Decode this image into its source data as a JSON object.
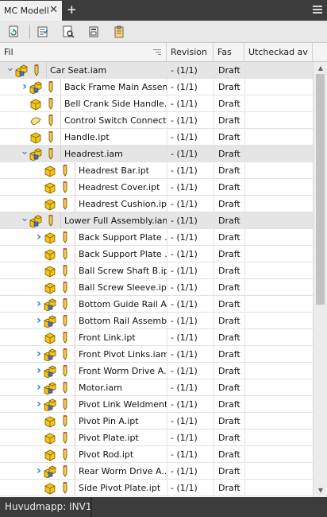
{
  "tab": {
    "title": "MC Modell",
    "close_glyph": "✕",
    "add_glyph": "+"
  },
  "toolbar": {
    "buttons": [
      {
        "name": "refresh-button",
        "icon": "refresh-doc-icon"
      },
      {
        "name": "properties-button",
        "icon": "properties-list-icon"
      },
      {
        "name": "search-button",
        "icon": "doc-search-icon"
      },
      {
        "name": "open-button",
        "icon": "open-doc-icon"
      },
      {
        "name": "clipboard-button",
        "icon": "clipboard-icon"
      }
    ]
  },
  "columns": {
    "fil": "Fil",
    "revision": "Revision",
    "fas": "Fas",
    "utcheckad": "Utcheckad av"
  },
  "rows": [
    {
      "name": "Car Seat.iam",
      "type": "assembly",
      "level": 0,
      "expander": "expanded",
      "rev": "- (1/1)",
      "fas": "Draft",
      "selected": true
    },
    {
      "name": "Back Frame Main Assem...",
      "type": "assembly",
      "level": 1,
      "expander": "collapsed",
      "rev": "- (1/1)",
      "fas": "Draft"
    },
    {
      "name": "Bell Crank Side Handle.ipt",
      "type": "part",
      "level": 1,
      "expander": "none",
      "rev": "- (1/1)",
      "fas": "Draft"
    },
    {
      "name": "Control Switch Connect...",
      "type": "surface",
      "level": 1,
      "expander": "none",
      "rev": "- (1/1)",
      "fas": "Draft"
    },
    {
      "name": "Handle.ipt",
      "type": "part",
      "level": 1,
      "expander": "none",
      "rev": "- (1/1)",
      "fas": "Draft"
    },
    {
      "name": "Headrest.iam",
      "type": "assembly",
      "level": 1,
      "expander": "expanded",
      "rev": "- (1/1)",
      "fas": "Draft",
      "selected": true
    },
    {
      "name": "Headrest Bar.ipt",
      "type": "part",
      "level": 2,
      "expander": "none",
      "rev": "- (1/1)",
      "fas": "Draft"
    },
    {
      "name": "Headrest Cover.ipt",
      "type": "part",
      "level": 2,
      "expander": "none",
      "rev": "- (1/1)",
      "fas": "Draft"
    },
    {
      "name": "Headrest Cushion.ipt",
      "type": "part",
      "level": 2,
      "expander": "none",
      "rev": "- (1/1)",
      "fas": "Draft"
    },
    {
      "name": "Lower Full Assembly.iam",
      "type": "assembly",
      "level": 1,
      "expander": "expanded",
      "rev": "- (1/1)",
      "fas": "Draft",
      "selected": true
    },
    {
      "name": "Back Support Plate ...",
      "type": "part",
      "level": 2,
      "expander": "collapsed",
      "rev": "- (1/1)",
      "fas": "Draft"
    },
    {
      "name": "Back Support Plate ...",
      "type": "part",
      "level": 2,
      "expander": "none",
      "rev": "- (1/1)",
      "fas": "Draft"
    },
    {
      "name": "Ball Screw Shaft B.ipt",
      "type": "part",
      "level": 2,
      "expander": "none",
      "rev": "- (1/1)",
      "fas": "Draft"
    },
    {
      "name": "Ball Screw Sleeve.ipt",
      "type": "part",
      "level": 2,
      "expander": "none",
      "rev": "- (1/1)",
      "fas": "Draft"
    },
    {
      "name": "Bottom Guide Rail A...",
      "type": "assembly",
      "level": 2,
      "expander": "collapsed",
      "rev": "- (1/1)",
      "fas": "Draft"
    },
    {
      "name": "Bottom Rail Assembl...",
      "type": "assembly",
      "level": 2,
      "expander": "collapsed",
      "rev": "- (1/1)",
      "fas": "Draft"
    },
    {
      "name": "Front Link.ipt",
      "type": "part",
      "level": 2,
      "expander": "none",
      "rev": "- (1/1)",
      "fas": "Draft"
    },
    {
      "name": "Front Pivot Links.iam",
      "type": "assembly",
      "level": 2,
      "expander": "collapsed",
      "rev": "- (1/1)",
      "fas": "Draft"
    },
    {
      "name": "Front Worm Drive A...",
      "type": "assembly",
      "level": 2,
      "expander": "collapsed",
      "rev": "- (1/1)",
      "fas": "Draft"
    },
    {
      "name": "Motor.iam",
      "type": "assembly",
      "level": 2,
      "expander": "collapsed",
      "rev": "- (1/1)",
      "fas": "Draft"
    },
    {
      "name": "Pivot Link Weldment...",
      "type": "assembly",
      "level": 2,
      "expander": "collapsed",
      "rev": "- (1/1)",
      "fas": "Draft"
    },
    {
      "name": "Pivot Pin A.ipt",
      "type": "part",
      "level": 2,
      "expander": "none",
      "rev": "- (1/1)",
      "fas": "Draft"
    },
    {
      "name": "Pivot Plate.ipt",
      "type": "part",
      "level": 2,
      "expander": "none",
      "rev": "- (1/1)",
      "fas": "Draft"
    },
    {
      "name": "Pivot Rod.ipt",
      "type": "part",
      "level": 2,
      "expander": "none",
      "rev": "- (1/1)",
      "fas": "Draft"
    },
    {
      "name": "Rear Worm Drive A...",
      "type": "assembly",
      "level": 2,
      "expander": "collapsed",
      "rev": "- (1/1)",
      "fas": "Draft"
    },
    {
      "name": "Side Pivot Plate.ipt",
      "type": "part",
      "level": 2,
      "expander": "none",
      "rev": "- (1/1)",
      "fas": "Draft"
    }
  ],
  "status": {
    "text": "Huvudmapp: INV1"
  },
  "colors": {
    "part_yellow": "#f5c518",
    "accent_blue": "#2b7bd1",
    "selected_row": "#e5e5e5"
  }
}
